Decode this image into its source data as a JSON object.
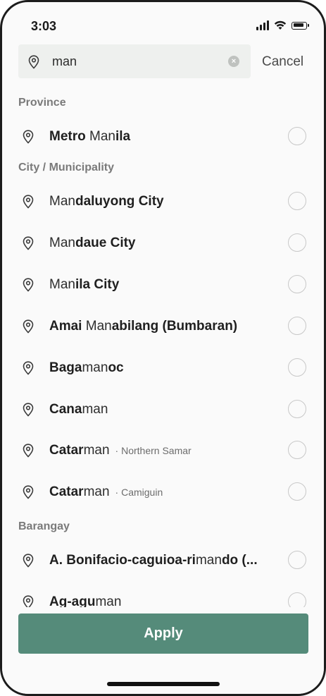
{
  "status_bar": {
    "time": "3:03"
  },
  "search": {
    "value": "man",
    "clear_glyph": "×",
    "cancel_label": "Cancel"
  },
  "sections": {
    "province": "Province",
    "city": "City / Municipality",
    "barangay": "Barangay"
  },
  "results": {
    "metro_manila": [
      {
        "t": "Metro",
        "b": true
      },
      {
        "t": " Man",
        "b": false
      },
      {
        "t": "ila",
        "b": true
      }
    ],
    "mandaluyong": [
      {
        "t": "Man",
        "b": false
      },
      {
        "t": "daluyong City",
        "b": true
      }
    ],
    "mandaue": [
      {
        "t": "Man",
        "b": false
      },
      {
        "t": "daue City",
        "b": true
      }
    ],
    "manila_city": [
      {
        "t": "Man",
        "b": false
      },
      {
        "t": "ila City",
        "b": true
      }
    ],
    "amai": [
      {
        "t": "Amai",
        "b": true
      },
      {
        "t": " Man",
        "b": false
      },
      {
        "t": "abilang (Bumbaran)",
        "b": true
      }
    ],
    "bagamanoc": [
      {
        "t": "Baga",
        "b": true
      },
      {
        "t": "man",
        "b": false
      },
      {
        "t": "oc",
        "b": true
      }
    ],
    "canaman": [
      {
        "t": "Cana",
        "b": true
      },
      {
        "t": "man",
        "b": false
      }
    ],
    "catarman_ns": [
      {
        "t": "Catar",
        "b": true
      },
      {
        "t": "man",
        "b": false
      }
    ],
    "catarman_ns_sub": "· Northern Samar",
    "catarman_cg": [
      {
        "t": "Catar",
        "b": true
      },
      {
        "t": "man",
        "b": false
      }
    ],
    "catarman_cg_sub": "· Camiguin",
    "bonifacio": [
      {
        "t": "A. Bonifacio-caguioa-ri",
        "b": true
      },
      {
        "t": "man",
        "b": false
      },
      {
        "t": "do (...",
        "b": true
      }
    ],
    "agaguman": [
      {
        "t": "Ag-agu",
        "b": true
      },
      {
        "t": "man",
        "b": false
      }
    ]
  },
  "apply_label": "Apply",
  "colors": {
    "accent": "#558b7a",
    "background": "#fafafa",
    "search_bg": "#eef0ee"
  },
  "icons": [
    "location-pin-icon",
    "clear-icon",
    "radio-button",
    "signal-icon",
    "wifi-icon",
    "battery-icon"
  ]
}
